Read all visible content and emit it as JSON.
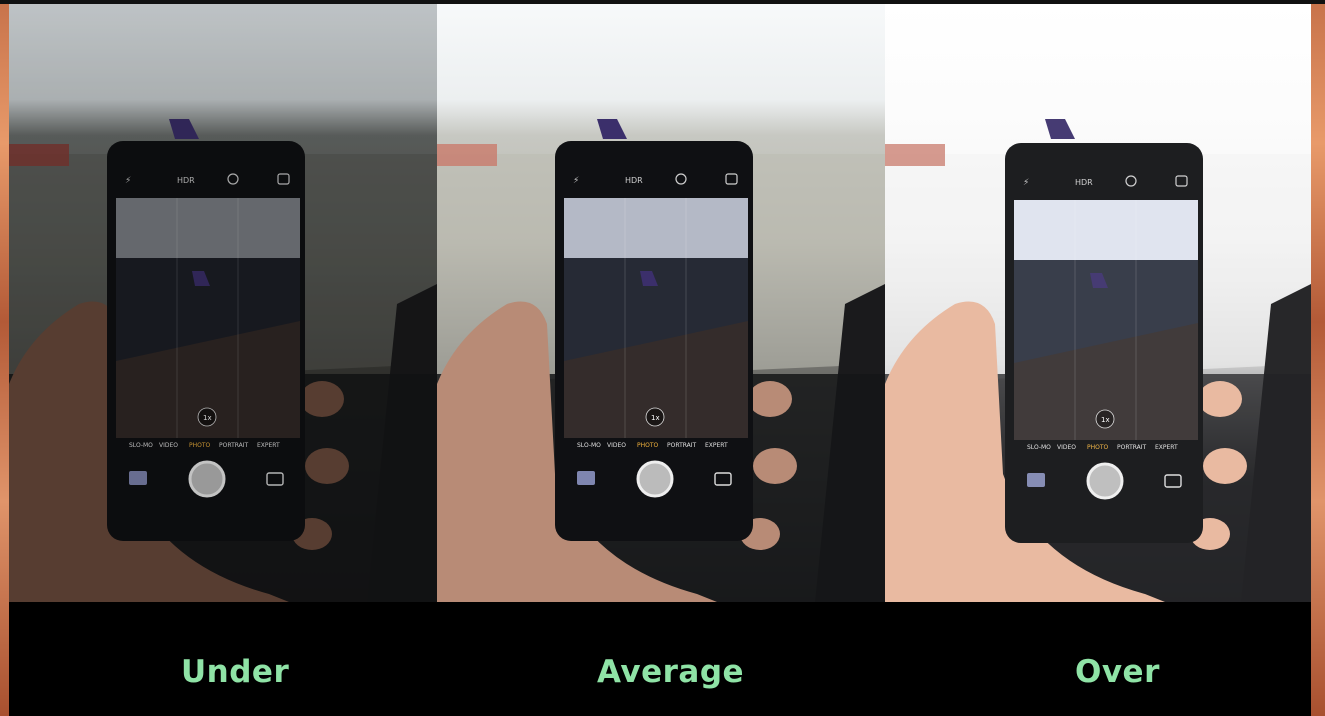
{
  "labels": {
    "under": "Under",
    "average": "Average",
    "over": "Over"
  },
  "phone_ui": {
    "hdr": "HDR",
    "modes": [
      "SLO-MO",
      "VIDEO",
      "PHOTO",
      "PORTRAIT",
      "EXPERT"
    ],
    "selected_mode": "PHOTO",
    "zoom": "1x"
  },
  "colors": {
    "label_text": "#8fe3a6",
    "selected_mode": "#f2b33d",
    "background": "#000000"
  }
}
